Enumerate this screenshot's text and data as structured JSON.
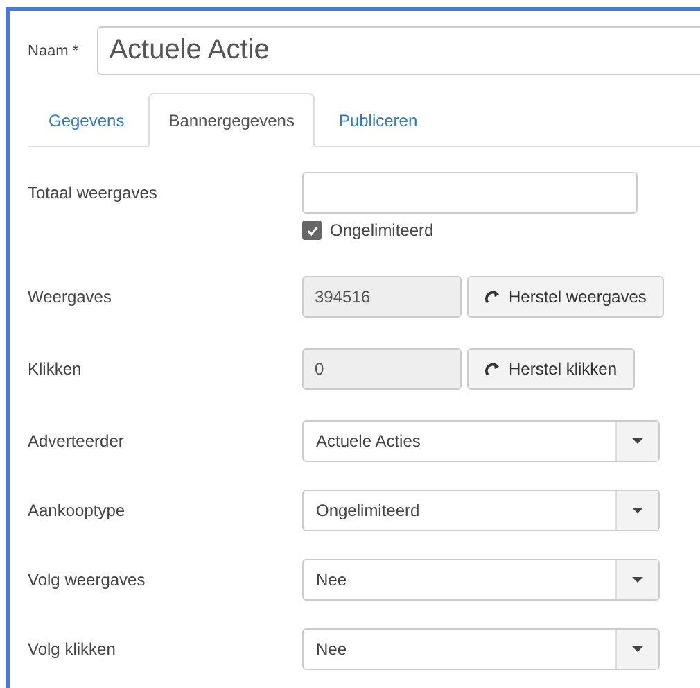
{
  "name_field": {
    "label": "Naam *",
    "value": "Actuele Actie"
  },
  "tabs": [
    {
      "label": "Gegevens",
      "selected": false
    },
    {
      "label": "Bannergegevens",
      "selected": true
    },
    {
      "label": "Publiceren",
      "selected": false
    }
  ],
  "fields": [
    {
      "kind": "text",
      "label": "Totaal weergaves",
      "checkbox": {
        "label": "Ongelimiteerd",
        "checked": true
      }
    },
    {
      "kind": "readonly",
      "label": "Weergaves",
      "value": "394516",
      "button": "Herstel weergaves"
    },
    {
      "kind": "readonly",
      "label": "Klikken",
      "value": "0",
      "button": "Herstel klikken"
    },
    {
      "kind": "select",
      "label": "Adverteerder",
      "value": "Actuele Acties"
    },
    {
      "kind": "select",
      "label": "Aankooptype",
      "value": "Ongelimiteerd"
    },
    {
      "kind": "select",
      "label": "Volg weergaves",
      "value": "Nee"
    },
    {
      "kind": "select",
      "label": "Volg klikken",
      "value": "Nee"
    }
  ]
}
